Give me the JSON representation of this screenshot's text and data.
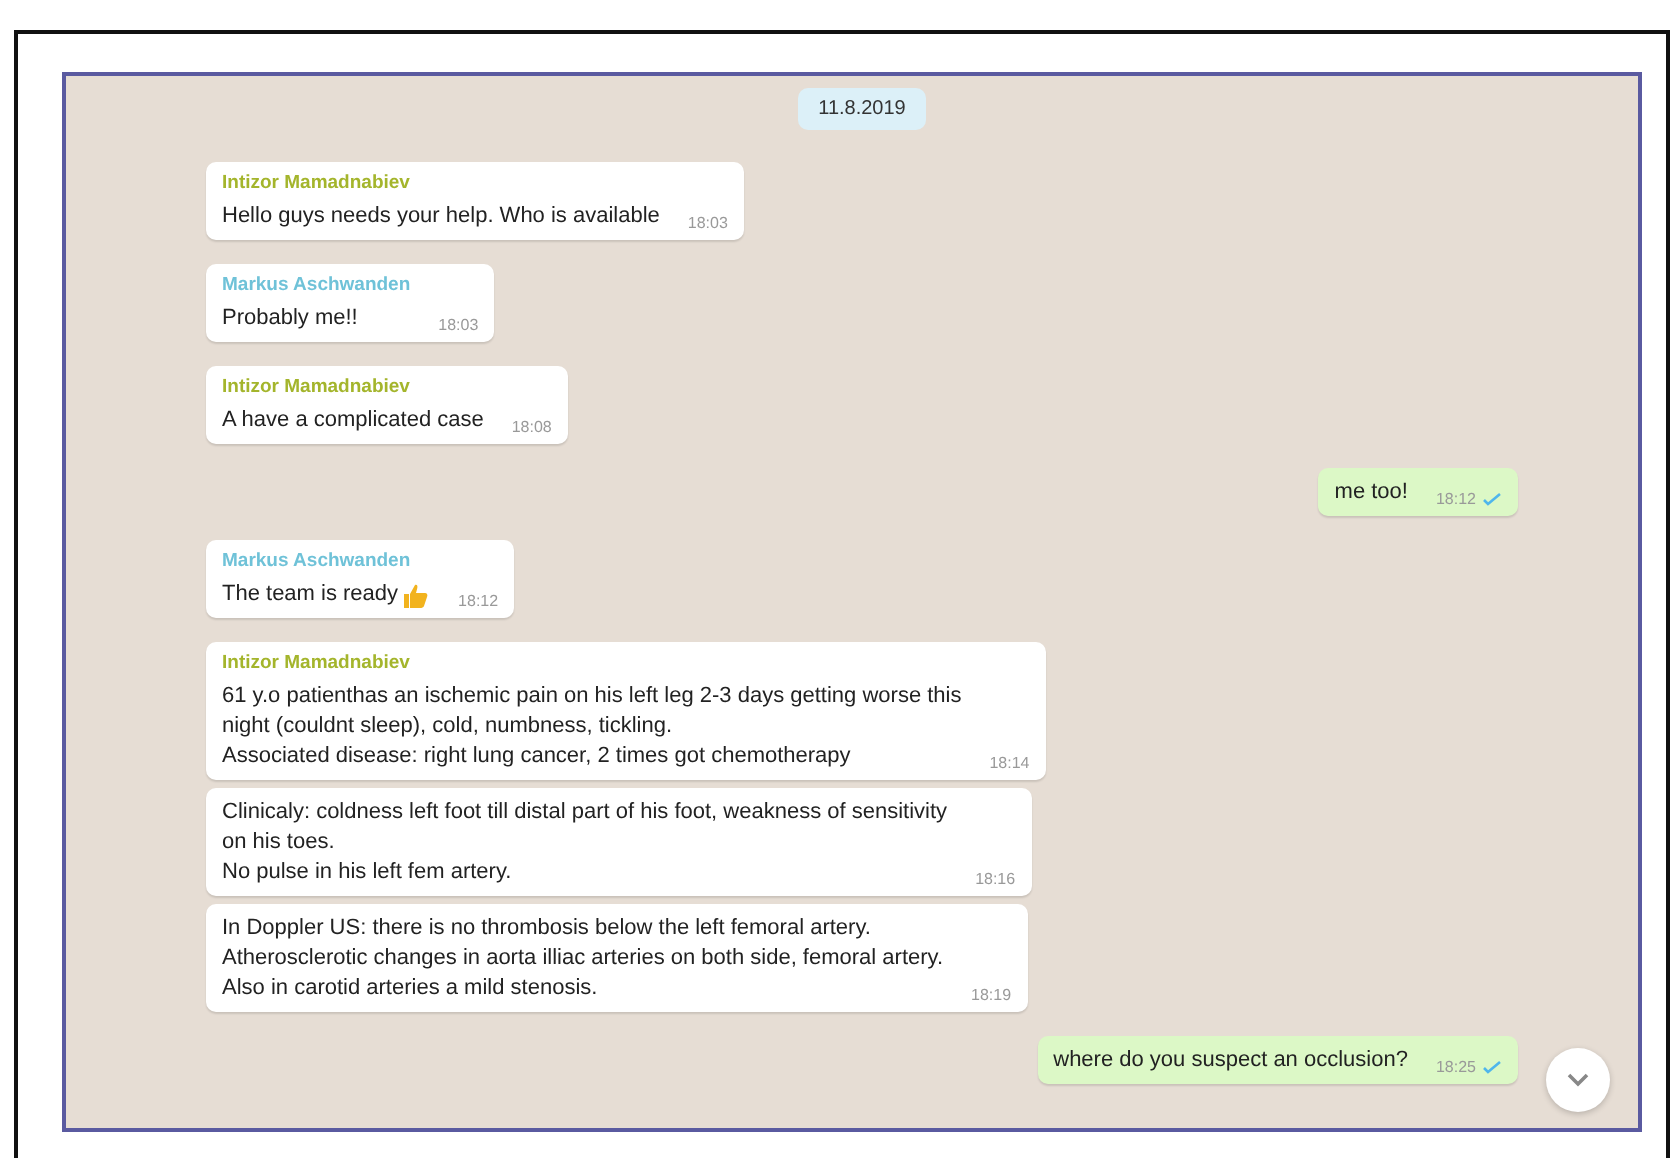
{
  "date_badge": "11.8.2019",
  "messages": [
    {
      "kind": "incoming",
      "sender": "Intizor Mamadnabiev",
      "color": "#a4b52c",
      "text": "Hello guys needs your help. Who is available",
      "time": "18:03"
    },
    {
      "kind": "incoming",
      "sender": "Markus Aschwanden",
      "color": "#6fc2d8",
      "text": "Probably me!!",
      "time": "18:03"
    },
    {
      "kind": "incoming",
      "sender": "Intizor Mamadnabiev",
      "color": "#a4b52c",
      "text": "A have a complicated case",
      "time": "18:08"
    },
    {
      "kind": "outgoing",
      "text": "me too!",
      "time": "18:12",
      "read": true
    },
    {
      "kind": "incoming",
      "sender": "Markus Aschwanden",
      "color": "#6fc2d8",
      "text": "The team is ready",
      "thumbs_up": true,
      "time": "18:12"
    },
    {
      "kind": "incoming",
      "sender": "Intizor Mamadnabiev",
      "color": "#a4b52c",
      "text": "61 y.o patienthas an ischemic pain on his left leg 2-3 days getting worse this\nnight (couldnt sleep), cold, numbness, tickling.\nAssociated disease: right lung cancer, 2 times got chemotherapy",
      "time": "18:14"
    },
    {
      "kind": "incoming",
      "text": "Clinicaly: coldness left foot till distal part of his foot, weakness of sensitivity\non his toes.\nNo pulse in his left fem artery.",
      "time": "18:16"
    },
    {
      "kind": "incoming",
      "text": "In Doppler US: there is no thrombosis below the left femoral artery.\nAtherosclerotic changes in aorta illiac arteries on both side, femoral artery.\nAlso in carotid arteries a mild stenosis.",
      "time": "18:19"
    },
    {
      "kind": "outgoing",
      "text": "where do you suspect an occlusion?",
      "time": "18:25",
      "read": true
    }
  ]
}
